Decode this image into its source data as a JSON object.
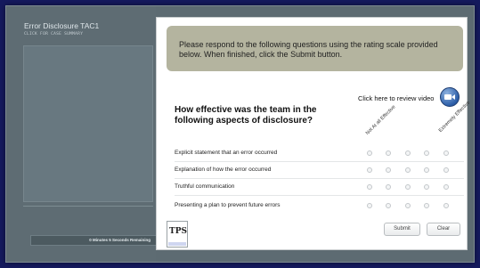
{
  "sidebar": {
    "title": "Error Disclosure TAC1",
    "subtitle": "CLICK FOR CASE SUMMARY",
    "timer": "0 Minutes 5 Seconds Remaining"
  },
  "main": {
    "instructions": "Please respond to the following questions using the rating scale provided below. When finished, click the Submit button.",
    "review_video_label": "Click here to review video",
    "question": "How effective was the team in the following aspects of disclosure?",
    "scale": {
      "low": "Not At all Effective",
      "high": "Extremely Effective"
    },
    "items": [
      "Explicit statement that an error occurred",
      "Explanation of how the error occurred",
      "Truthful communication",
      "Presenting a plan to prevent future errors"
    ],
    "buttons": {
      "submit": "Submit",
      "clear": "Clear"
    },
    "logo_text": "TPS"
  },
  "icons": {
    "video": "video-review-icon",
    "logo": "tps-logo-icon"
  }
}
